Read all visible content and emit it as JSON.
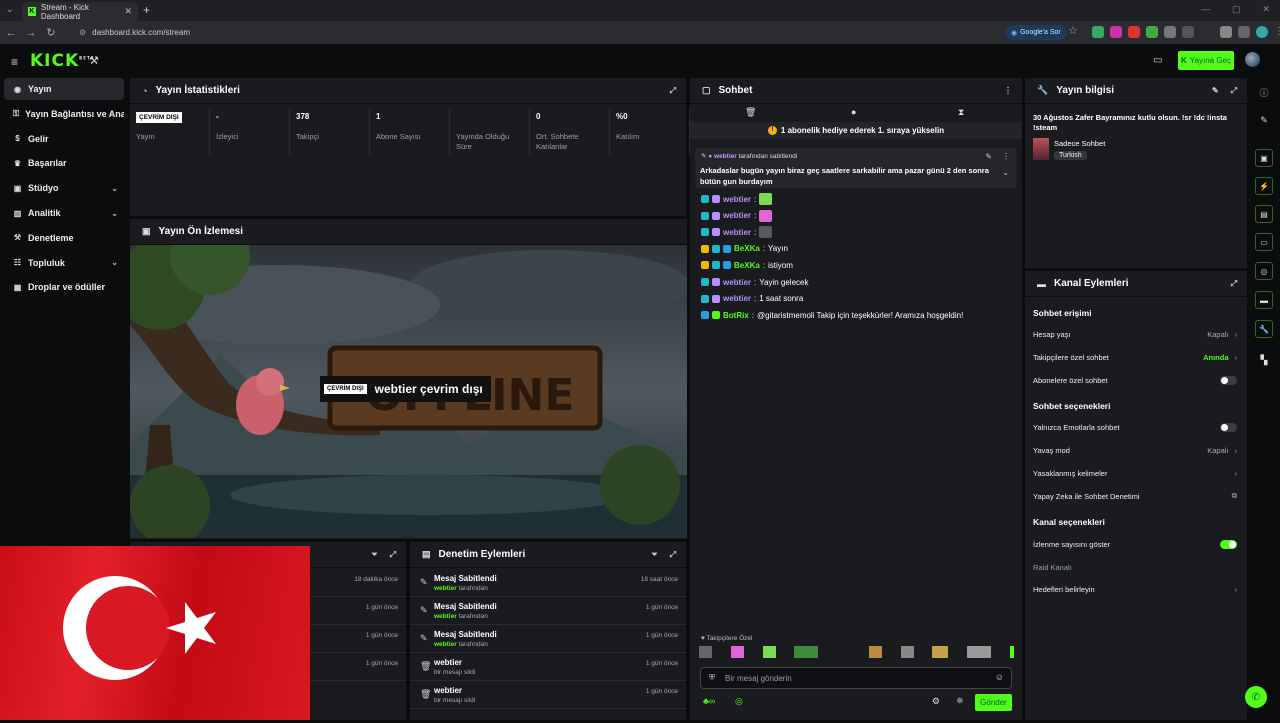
{
  "browser": {
    "tab_title": "Stream - Kick Dashboard",
    "url": "dashboard.kick.com/stream",
    "google_btn": "Google'a Sor"
  },
  "header": {
    "logo": "KICK",
    "logo_sup": "BETA",
    "go_live": "Yayına Geç"
  },
  "sidebar": {
    "items": [
      {
        "label": "Yayın",
        "icon": "broadcast-icon",
        "has_chevron": false
      },
      {
        "label": "Yayın Bağlantısı ve Anahtarı",
        "icon": "key-icon",
        "has_chevron": false
      },
      {
        "label": "Gelir",
        "icon": "money-icon",
        "has_chevron": false
      },
      {
        "label": "Başarılar",
        "icon": "trophy-icon",
        "has_chevron": false
      },
      {
        "label": "Stüdyo",
        "icon": "studio-icon",
        "has_chevron": true
      },
      {
        "label": "Analitik",
        "icon": "analytics-icon",
        "has_chevron": true
      },
      {
        "label": "Denetleme",
        "icon": "moderation-icon",
        "has_chevron": false
      },
      {
        "label": "Topluluk",
        "icon": "community-icon",
        "has_chevron": true
      },
      {
        "label": "Droplar ve ödüller",
        "icon": "gift-icon",
        "has_chevron": false
      }
    ]
  },
  "stats": {
    "title": "Yayın İstatistikleri",
    "items": [
      {
        "value": "ÇEVRİM DIŞI",
        "label": "Yayın"
      },
      {
        "value": "-",
        "label": "İzleyici"
      },
      {
        "value": "378",
        "label": "Takipçi"
      },
      {
        "value": "1",
        "label": "Abone Sayısı"
      },
      {
        "value": "",
        "label": "Yayında Olduğu Süre"
      },
      {
        "value": "0",
        "label": "Ort. Sohbete Katılanlar"
      },
      {
        "value": "%0",
        "label": "Katılım"
      }
    ]
  },
  "preview": {
    "title": "Yayın Ön İzlemesi",
    "badge": "ÇEVRİM DIŞI",
    "offline_text": "webtier çevrim dışı"
  },
  "activity": {
    "rows": [
      {
        "time": "18 dakika önce"
      },
      {
        "time": "1 gün önce"
      },
      {
        "time": "1 gün önce"
      },
      {
        "time": "1 gün önce"
      }
    ]
  },
  "moderation": {
    "title": "Denetim Eylemleri",
    "rows": [
      {
        "title": "Mesaj Sabitlendi",
        "user": "webtier",
        "suffix": "tarafından",
        "time": "18 saat önce",
        "icon": "pin-icon"
      },
      {
        "title": "Mesaj Sabitlendi",
        "user": "webtier",
        "suffix": "tarafından",
        "time": "1 gün önce",
        "icon": "pin-icon"
      },
      {
        "title": "Mesaj Sabitlendi",
        "user": "webtier",
        "suffix": "tarafından",
        "time": "1 gün önce",
        "icon": "pin-icon"
      },
      {
        "title": "webtier",
        "user": "",
        "suffix": "bir mesajı sildi",
        "time": "1 gün önce",
        "icon": "trash-icon"
      },
      {
        "title": "webtier",
        "user": "",
        "suffix": "bir mesajı sildi",
        "time": "1 gün önce",
        "icon": "trash-icon"
      }
    ]
  },
  "chat": {
    "title": "Sohbet",
    "gift_banner": "1 abonelik hediye ederek 1. sıraya yükselin",
    "pinned_by_user": "webtier",
    "pinned_by_suffix": "tarafından sabitlendi",
    "pinned_message": "Arkadaslar bugün yayın biraz geç saatlere sarkabilir ama pazar günü 2 den sonra bütün gun burdayım",
    "messages": [
      {
        "user": "webtier",
        "text": "",
        "color": "#b98cff",
        "emote": "#7ed957"
      },
      {
        "user": "webtier",
        "text": "",
        "color": "#b98cff",
        "emote": "#e066d6"
      },
      {
        "user": "webtier",
        "text": "",
        "color": "#b98cff",
        "emote": "#555b63"
      },
      {
        "user": "BeXKa",
        "text": "Yayın",
        "color": "#53fc18",
        "emote": ""
      },
      {
        "user": "BeXKa",
        "text": "istiyom",
        "color": "#53fc18",
        "emote": ""
      },
      {
        "user": "webtier",
        "text": "Yayin gelecek",
        "color": "#b98cff",
        "emote": ""
      },
      {
        "user": "webtier",
        "text": "1 saat sonra",
        "color": "#b98cff",
        "emote": ""
      },
      {
        "user": "BotRix",
        "text": "@gitaristmemoli Takip için teşekkürler! Aramıza hoşgeldin!",
        "color": "#53fc18",
        "emote": ""
      }
    ],
    "followers_only_label": "Takipçilere Özel",
    "input_placeholder": "Bir mesaj gönderin",
    "send_label": "Gönder"
  },
  "stream_info": {
    "title": "Yayın bilgisi",
    "stream_title": "30 Ağustos Zafer Bayramınız kutlu olsun. !sr !dc !insta !steam",
    "category": "Sadece Sohbet",
    "tag": "Turkish"
  },
  "channel_actions": {
    "title": "Kanal Eylemleri",
    "chat_access_title": "Sohbet erişimi",
    "chat_options_title": "Sohbet seçenekleri",
    "channel_options_title": "Kanal seçenekleri",
    "rows": {
      "account_age": {
        "label": "Hesap yaşı",
        "value": "Kapalı"
      },
      "followers_chat": {
        "label": "Takipçilere özel sohbet",
        "value": "Anında"
      },
      "subs_chat": {
        "label": "Abonelere özel sohbet"
      },
      "emotes_only": {
        "label": "Yalnızca Emotlarla sohbet"
      },
      "slow_mode": {
        "label": "Yavaş mod",
        "value": "Kapalı"
      },
      "banned_words": {
        "label": "Yasaklanmış kelimeler"
      },
      "ai_moderation": {
        "label": "Yapay Zeka ile Sohbet Denetimi"
      },
      "show_viewers": {
        "label": "İzlenme sayısını göster"
      },
      "raid": {
        "label": "Raid Kanalı"
      },
      "targets": {
        "label": "Hedefleri belirleyin"
      }
    }
  },
  "colors": {
    "accent": "#53fc18",
    "panel_bg": "#191b1f",
    "page_bg": "#0b0c0e",
    "flag_red": "#e30a17"
  }
}
